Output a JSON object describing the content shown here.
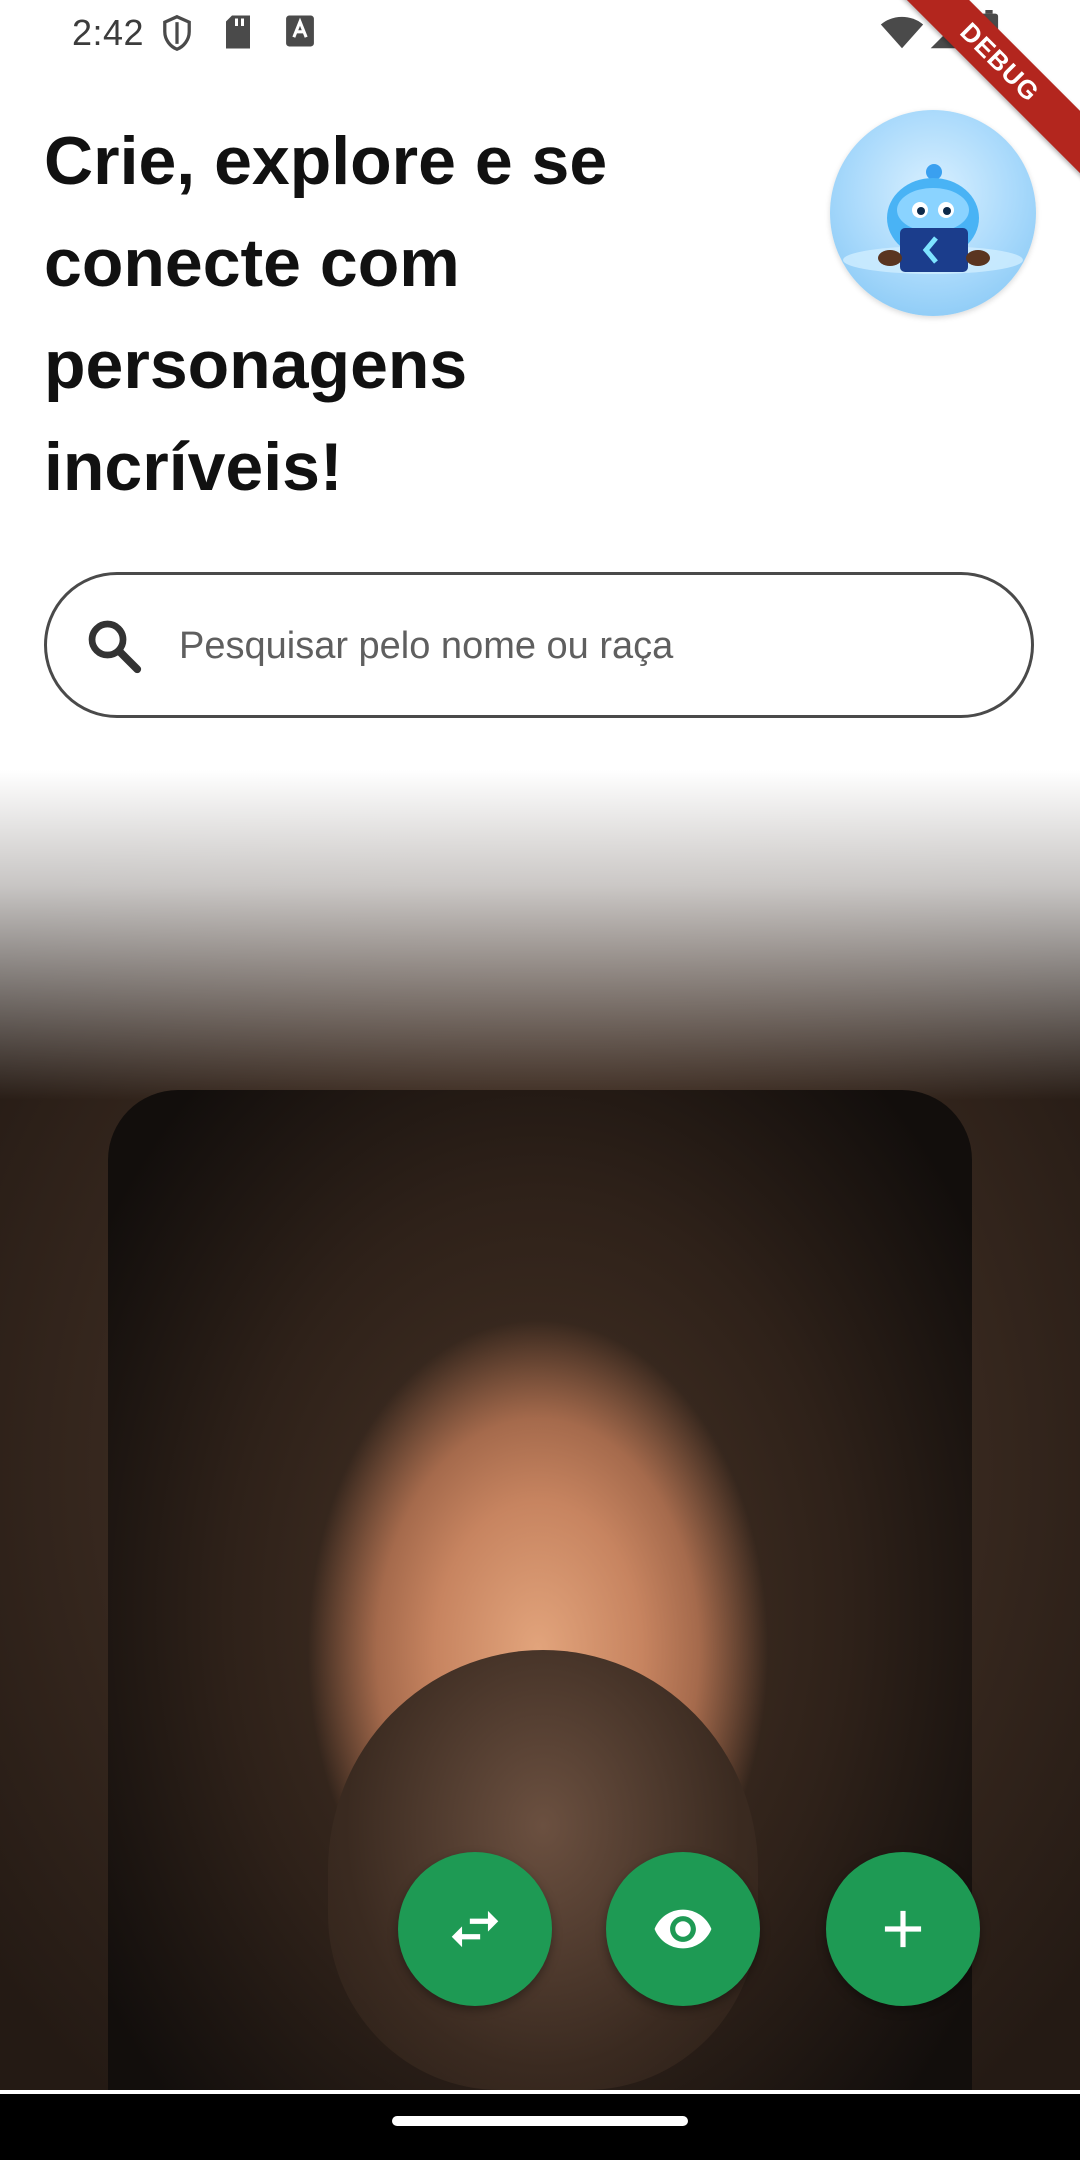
{
  "status_bar": {
    "time": "2:42",
    "left_icons": [
      "shield-icon",
      "sd-card-icon",
      "keyboard-a-icon"
    ],
    "right_icons": [
      "wifi-icon",
      "signal-icon",
      "battery-icon"
    ],
    "debug_label": "DEBUG"
  },
  "header": {
    "headline": "Crie, explore e se conecte com personagens incríveis!",
    "avatar_icon": "flutter-mascot-avatar"
  },
  "search": {
    "placeholder": "Pesquisar pelo nome ou raça",
    "value": ""
  },
  "character_card": {
    "image": "portrait-photo"
  },
  "actions": {
    "swap_icon": "swap-horiz-icon",
    "view_icon": "eye-icon",
    "add_icon": "plus-icon",
    "fab_color": "#1e9a54"
  },
  "colors": {
    "debug_ribbon": "#b3261e",
    "headline": "#111111",
    "search_border": "#4a4a4a"
  }
}
